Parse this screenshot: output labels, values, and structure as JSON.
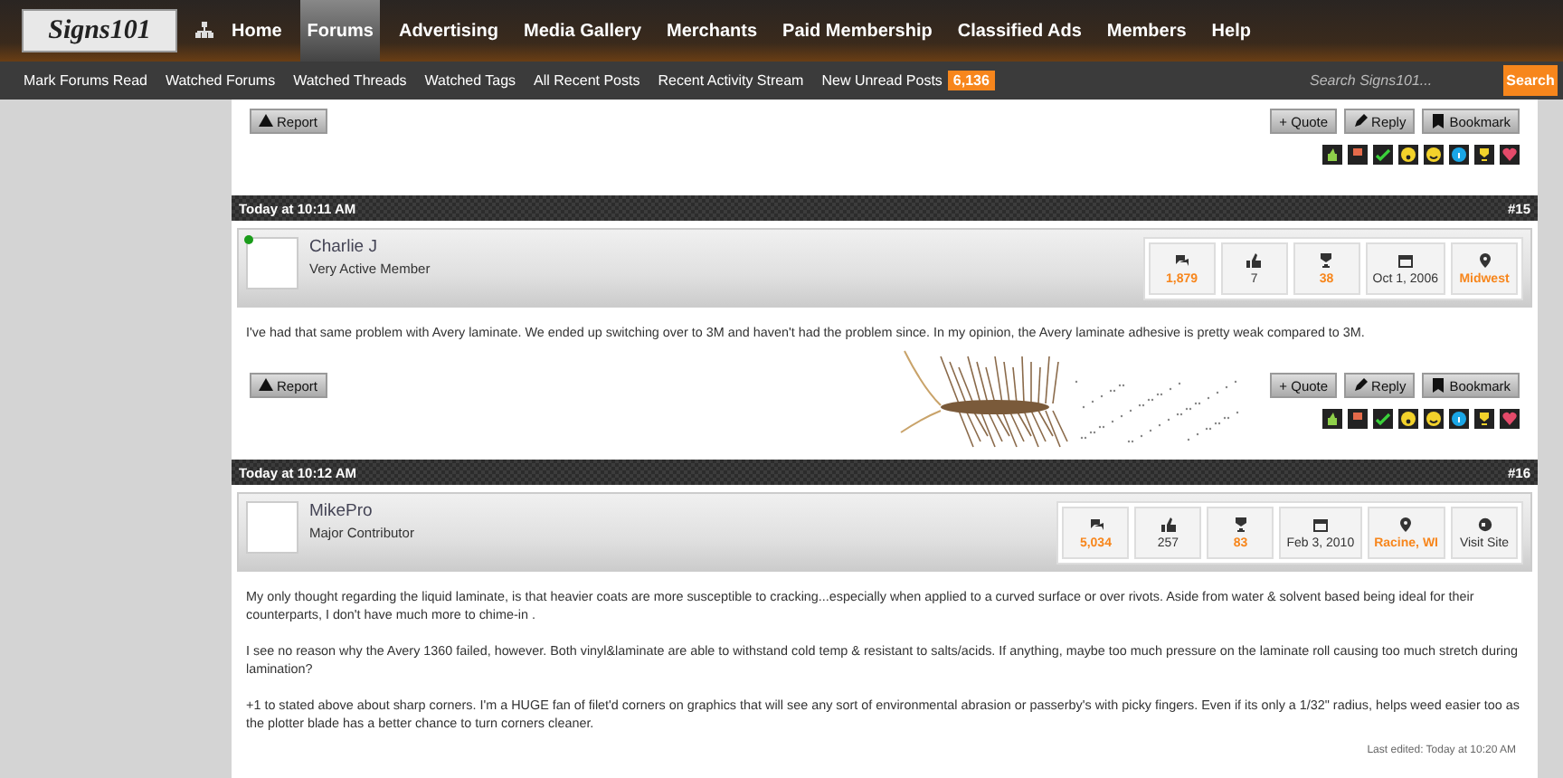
{
  "header": {
    "logo_text": "Signs101",
    "nav": [
      {
        "label": "Home",
        "selected": false
      },
      {
        "label": "Forums",
        "selected": true
      },
      {
        "label": "Advertising",
        "selected": false
      },
      {
        "label": "Media Gallery",
        "selected": false
      },
      {
        "label": "Merchants",
        "selected": false
      },
      {
        "label": "Paid Membership",
        "selected": false
      },
      {
        "label": "Classified Ads",
        "selected": false
      },
      {
        "label": "Members",
        "selected": false
      },
      {
        "label": "Help",
        "selected": false
      }
    ]
  },
  "subnav": {
    "links": [
      "Mark Forums Read",
      "Watched Forums",
      "Watched Threads",
      "Watched Tags",
      "All Recent Posts",
      "Recent Activity Stream",
      "New Unread Posts"
    ],
    "unread_badge": "6,136",
    "search": {
      "placeholder": "Search Signs101..."
    },
    "search_button": "Search"
  },
  "previous_post_footer": {
    "report": "Report",
    "actions": [
      "+ Quote",
      "Reply",
      "Bookmark"
    ]
  },
  "posts": [
    {
      "time": "Today at 10:11 AM",
      "number": "#15",
      "author": "Charlie J",
      "role": "Very Active Member",
      "online": true,
      "stats": [
        {
          "kind": "messages",
          "value": "1,879",
          "highlight": true
        },
        {
          "kind": "likes",
          "value": "7",
          "highlight": false
        },
        {
          "kind": "trophy",
          "value": "38",
          "highlight": true
        },
        {
          "kind": "joined",
          "value": "Oct 1, 2006",
          "highlight": false
        },
        {
          "kind": "location",
          "value": "Midwest",
          "highlight": true
        }
      ],
      "paragraphs": [
        "I've had that same problem with Avery laminate. We ended up switching over to 3M and haven't had the problem since. In my opinion, the Avery laminate adhesive is pretty weak compared to 3M."
      ],
      "footer": {
        "report": "Report",
        "actions": [
          "+ Quote",
          "Reply",
          "Bookmark"
        ]
      }
    },
    {
      "time": "Today at 10:12 AM",
      "number": "#16",
      "author": "MikePro",
      "role": "Major Contributor",
      "online": false,
      "stats": [
        {
          "kind": "messages",
          "value": "5,034",
          "highlight": true
        },
        {
          "kind": "likes",
          "value": "257",
          "highlight": false
        },
        {
          "kind": "trophy",
          "value": "83",
          "highlight": true
        },
        {
          "kind": "joined",
          "value": "Feb 3, 2010",
          "highlight": false
        },
        {
          "kind": "location",
          "value": "Racine, WI",
          "highlight": true
        },
        {
          "kind": "website",
          "value": "Visit Site",
          "highlight": false
        }
      ],
      "paragraphs": [
        "My only thought regarding the liquid laminate, is that heavier coats are more susceptible to cracking...especially when applied to a curved surface or over rivots. Aside from water & solvent based being ideal for their counterparts, I don't have much more to chime-in .",
        "I see no reason why the Avery 1360 failed, however. Both vinyl&laminate are able to withstand cold temp & resistant to salts/acids. If anything, maybe too much pressure on the laminate roll causing too much stretch during lamination?",
        "+1 to stated above about sharp corners. I'm a HUGE fan of filet'd corners on graphics that will see any sort of environmental abrasion or passerby's with picky fingers. Even if its only a 1/32\" radius, helps weed easier too as the plotter blade has a better chance to turn corners cleaner."
      ],
      "last_edited": "Last edited: Today at 10:20 AM"
    }
  ]
}
